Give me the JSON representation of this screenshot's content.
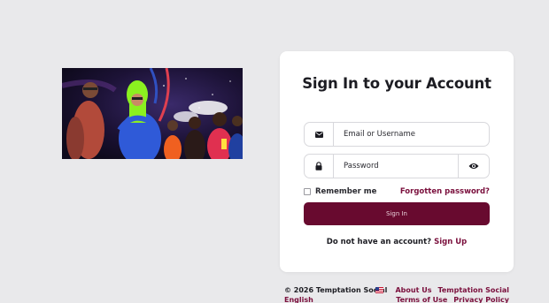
{
  "form": {
    "title": "Sign In to your Account",
    "username_placeholder": "Email or Username",
    "password_placeholder": "Password",
    "remember_label": "Remember me",
    "forgot_label": "Forgotten password?",
    "signin_label": "Sign In",
    "no_account_text": "Do not have an account?",
    "signup_label": "Sign Up"
  },
  "footer": {
    "copyright": "© 2026 Temptation Social",
    "language": "English",
    "links_row1": [
      "About Us",
      "Temptation Social"
    ],
    "links_row2": [
      "Terms of Use",
      "Privacy Policy"
    ]
  },
  "colors": {
    "accent": "#680a2f",
    "link": "#7a0f3c",
    "background": "#e9e9eb"
  },
  "icons": {
    "username": "envelope-icon",
    "password": "lock-icon",
    "toggle": "eye-icon",
    "language": "us-flag-icon"
  }
}
